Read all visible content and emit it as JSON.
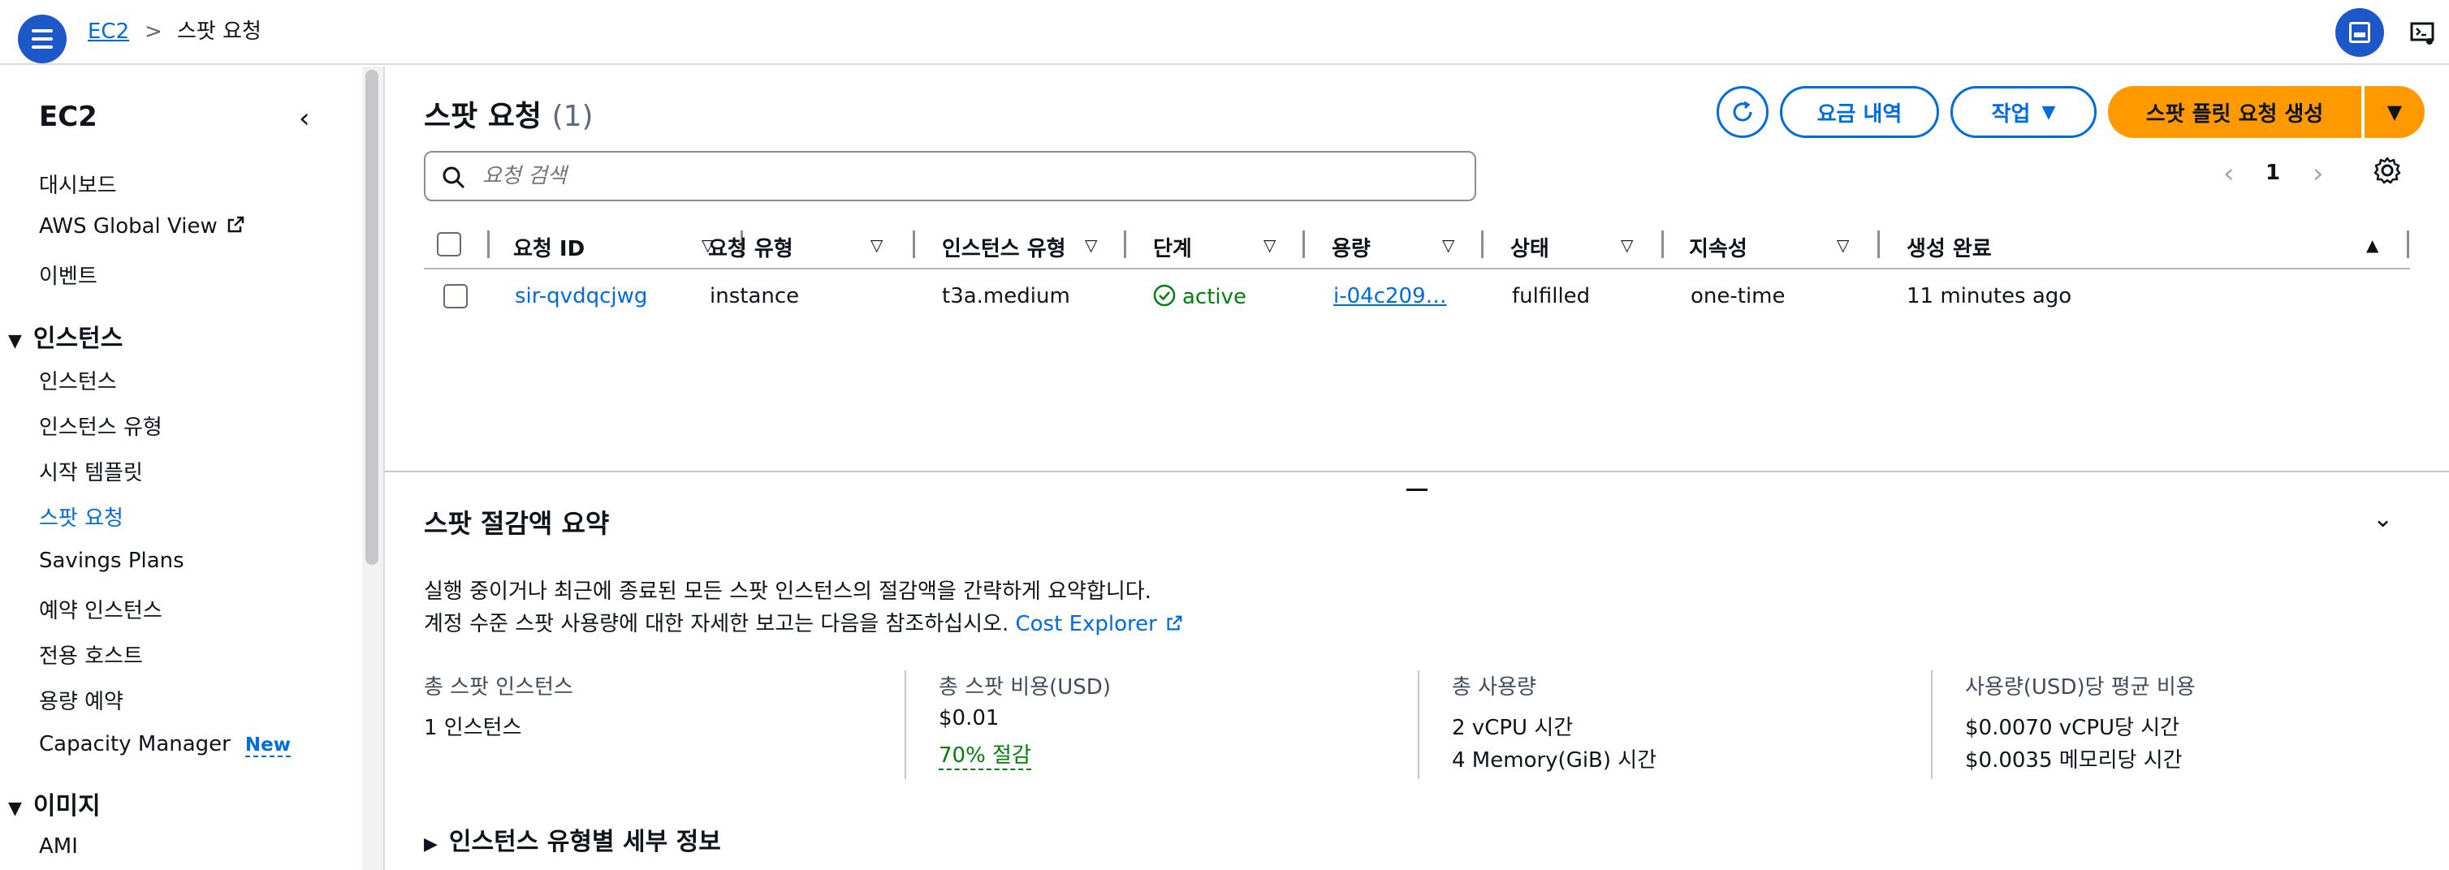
{
  "breadcrumb": {
    "root": "EC2",
    "separator": ">",
    "current": "스팟 요청"
  },
  "sidebar": {
    "title": "EC2",
    "items_top": [
      "대시보드",
      "AWS Global View",
      "이벤트"
    ],
    "group_instances": "인스턴스",
    "instances_items": [
      "인스턴스",
      "인스턴스 유형",
      "시작 템플릿",
      "스팟 요청",
      "Savings Plans",
      "예약 인스턴스",
      "전용 호스트",
      "용량 예약",
      "Capacity Manager"
    ],
    "new_badge": "New",
    "group_images": "이미지",
    "images_items": [
      "AMI"
    ]
  },
  "page": {
    "title": "스팟 요청",
    "count": "(1)",
    "pricing_button": "요금 내역",
    "actions_button": "작업",
    "create_button": "스팟 플릿 요청 생성",
    "search_placeholder": "요청 검색",
    "page_number": "1"
  },
  "table": {
    "columns": [
      "요청 ID",
      "요청 유형",
      "인스턴스 유형",
      "단계",
      "용량",
      "상태",
      "지속성",
      "생성 완료"
    ],
    "rows": [
      {
        "request_id": "sir-qvdqcjwg",
        "request_type": "instance",
        "instance_type": "t3a.medium",
        "phase": "active",
        "capacity": "i-04c209…",
        "state": "fulfilled",
        "persistence": "one-time",
        "created": "11 minutes ago"
      }
    ]
  },
  "summary": {
    "title": "스팟 절감액 요약",
    "desc1": "실행 중이거나 최근에 종료된 모든 스팟 인스턴스의 절감액을 간략하게 요약합니다.",
    "desc2": "계정 수준 스팟 사용량에 대한 자세한 보고는 다음을 참조하십시오.",
    "cost_explorer_link": "Cost Explorer",
    "metrics": [
      {
        "label": "총 스팟 인스턴스",
        "values": [
          "1 인스턴스"
        ]
      },
      {
        "label": "총 스팟 비용(USD)",
        "values": [
          "$0.01",
          "70% 절감"
        ]
      },
      {
        "label": "총 사용량",
        "values": [
          "2 vCPU 시간",
          "4 Memory(GiB) 시간"
        ]
      },
      {
        "label": "사용량(USD)당 평균 비용",
        "values": [
          "$0.0070 vCPU당 시간",
          "$0.0035 메모리당 시간"
        ]
      }
    ],
    "details_label": "인스턴스 유형별 세부 정보"
  },
  "colors": {
    "primary": "#ff9900",
    "link": "#006ce0",
    "success": "#037f0c",
    "nav_blue": "#1d58c8"
  }
}
